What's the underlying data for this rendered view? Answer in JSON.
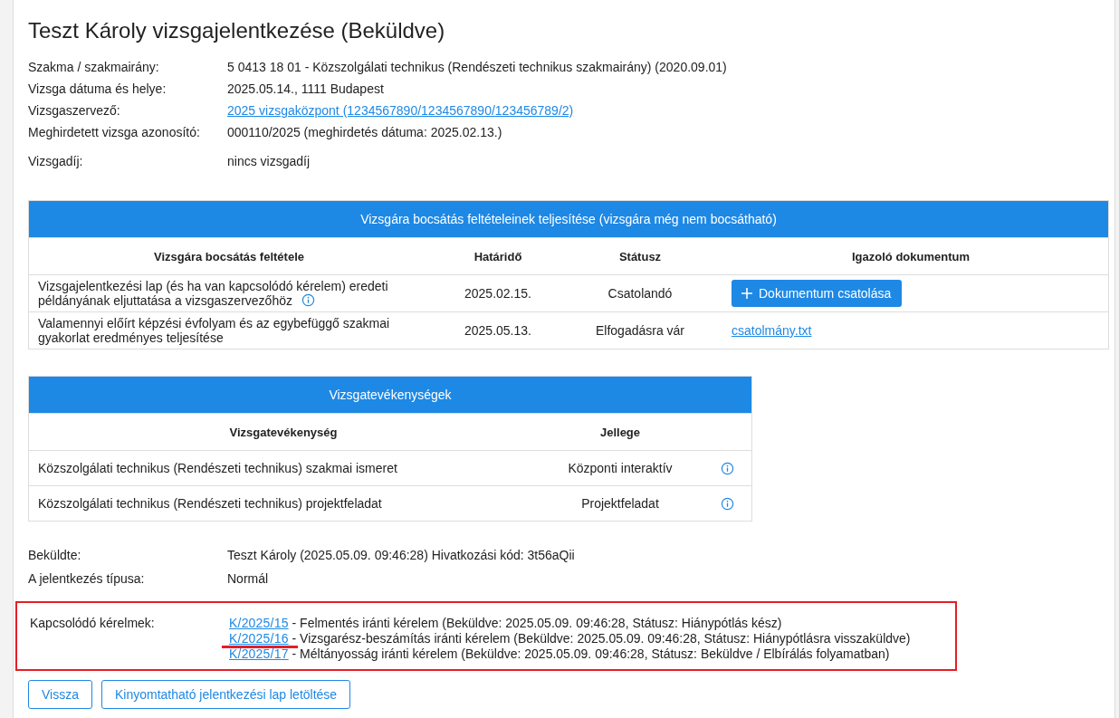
{
  "title": "Teszt Károly vizsgajelentkezése (Beküldve)",
  "details": [
    {
      "label": "Szakma / szakmairány:",
      "value": "5 0413 18 01 - Közszolgálati technikus (Rendészeti technikus szakmairány) (2020.09.01)",
      "kind": "text"
    },
    {
      "label": "Vizsga dátuma és helye:",
      "value": "2025.05.14., 1111 Budapest",
      "kind": "text"
    },
    {
      "label": "Vizsgaszervező:",
      "value": "2025 vizsgaközpont (1234567890/1234567890/123456789/2)",
      "kind": "link"
    },
    {
      "label": "Meghirdetett vizsga azonosító:",
      "value": "000110/2025 (meghirdetés dátuma: 2025.02.13.)",
      "kind": "text"
    },
    {
      "label": "Vizsgadíj:",
      "value": "nincs vizsgadíj",
      "kind": "text"
    }
  ],
  "conditions": {
    "title": "Vizsgára bocsátás feltételeinek teljesítése (vizsgára még nem bocsátható)",
    "columns": [
      "Vizsgára bocsátás feltétele",
      "Határidő",
      "Státusz",
      "Igazoló dokumentum"
    ],
    "rows": [
      {
        "condition": "Vizsgajelentkezési lap (és ha van kapcsolódó kérelem) eredeti példányának eljuttatása a vizsgaszervezőhöz",
        "info": true,
        "deadline": "2025.02.15.",
        "status": "Csatolandó",
        "document": {
          "kind": "button",
          "text": "Dokumentum csatolása"
        }
      },
      {
        "condition": "Valamennyi előírt képzési évfolyam és az egybefüggő szakmai gyakorlat eredményes teljesítése",
        "info": false,
        "deadline": "2025.05.13.",
        "status": "Elfogadásra vár",
        "document": {
          "kind": "link",
          "text": "csatolmány.txt"
        }
      }
    ]
  },
  "activities": {
    "title": "Vizsgatevékenységek",
    "columns": [
      "Vizsgatevékenység",
      "Jellege"
    ],
    "rows": [
      {
        "name": "Közszolgálati technikus (Rendészeti technikus) szakmai ismeret",
        "type": "Központi interaktív"
      },
      {
        "name": "Közszolgálati technikus (Rendészeti technikus) projektfeladat",
        "type": "Projektfeladat"
      }
    ]
  },
  "submission": [
    {
      "label": "Beküldte:",
      "value": "Teszt Károly (2025.05.09. 09:46:28) Hivatkozási kód: 3t56aQii"
    },
    {
      "label": "A jelentkezés típusa:",
      "value": "Normál"
    }
  ],
  "related": {
    "label": "Kapcsolódó kérelmek:",
    "highlighted": true,
    "items": [
      {
        "code": "K/2025/15",
        "text": " - Felmentés iránti kérelem (Beküldve: 2025.05.09. 09:46:28, Státusz: Hiánypótlás kész)",
        "marked": false
      },
      {
        "code": "K/2025/16",
        "text": " - Vizsgarész-beszámítás iránti kérelem (Beküldve: 2025.05.09. 09:46:28, Státusz: Hiánypótlásra visszaküldve)",
        "marked": true
      },
      {
        "code": "K/2025/17",
        "text": " - Méltányosság iránti kérelem (Beküldve: 2025.05.09. 09:46:28, Státusz: Beküldve / Elbírálás folyamatban)",
        "marked": false
      }
    ]
  },
  "buttons": [
    "Vissza",
    "Kinyomtatható jelentkezési lap letöltése"
  ]
}
